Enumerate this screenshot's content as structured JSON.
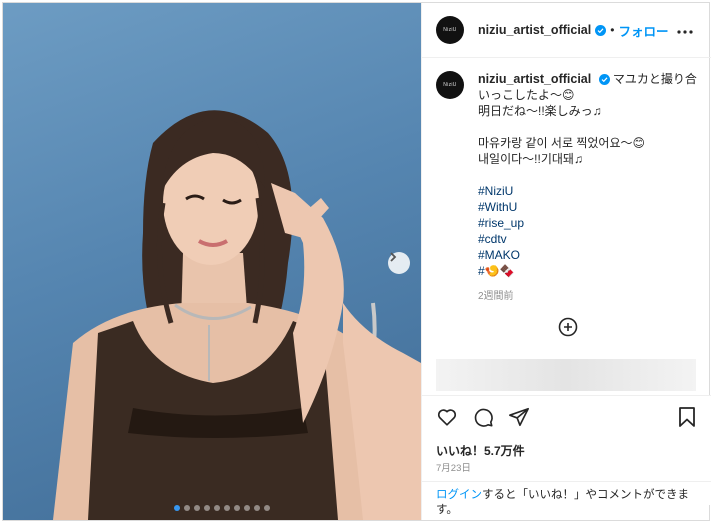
{
  "post": {
    "username": "niziu_artist_official",
    "avatar_text": "NiziU",
    "follow_label": "フォロー",
    "separator": "•",
    "more_icon": "more-horizontal-icon",
    "verified_icon": "verified-badge-icon"
  },
  "photo": {
    "carousel_total": 10,
    "carousel_active": 1,
    "next_icon": "chevron-right-icon"
  },
  "caption": {
    "username": "niziu_artist_official",
    "lines": [
      "マユカと撮り合いっこしたよ～😊",
      "明日だね～!!楽しみっ♫",
      "",
      "마유카랑 같이 서로 찍었어요～😊",
      "내일이다～!!기대돼♫"
    ],
    "hashtags": [
      "#NiziU",
      "#WithU",
      "#rise_up",
      "#cdtv",
      "#MAKO",
      "#🍤🍫"
    ],
    "time_ago": "2週間前"
  },
  "actions": {
    "likes": "いいね！5.7万件",
    "date": "7月23日",
    "icons": [
      "heart-icon",
      "comment-icon",
      "share-icon",
      "bookmark-icon"
    ]
  },
  "login": {
    "link": "ログイン",
    "rest": "すると「いいね！」やコメントができます。"
  },
  "colors": {
    "accent": "#0095f6",
    "hashtag": "#00376b",
    "muted": "#8e8e8e"
  }
}
